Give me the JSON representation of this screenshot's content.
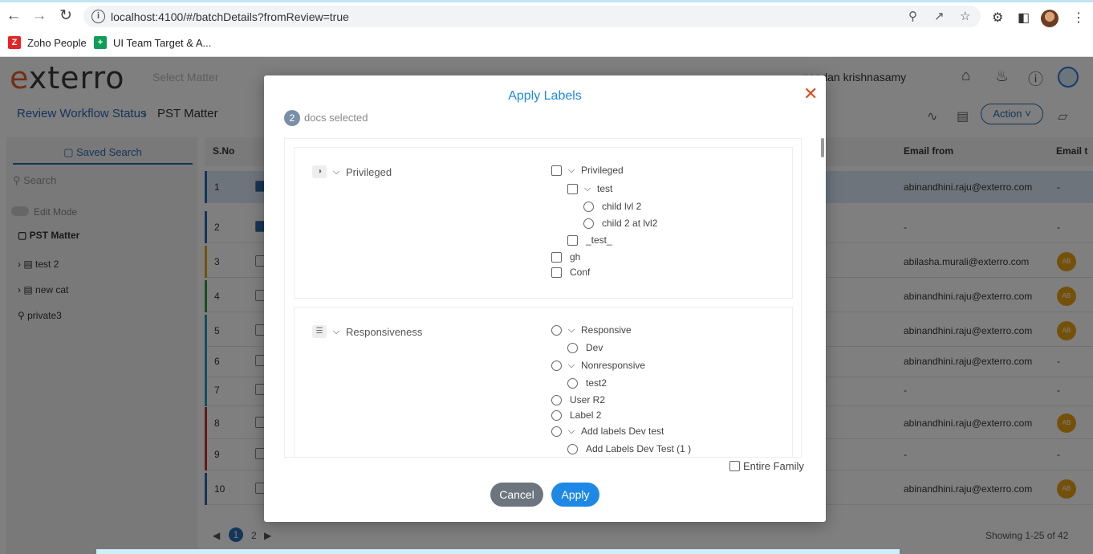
{
  "browser": {
    "url": "localhost:4100/#/batchDetails?fromReview=true",
    "bookmarks": [
      {
        "label": "Zoho People",
        "logo": "Z",
        "color": "#e42527"
      },
      {
        "label": "UI Team Target & A...",
        "logo": "+",
        "color": "#0f9d58"
      }
    ]
  },
  "app": {
    "brand": "exterro",
    "select_matter_placeholder": "Select Matter",
    "user_name": "nandan krishnasamy",
    "breadcrumb": [
      "Review Workflow Status",
      "PST Matter"
    ],
    "action_label": "Action"
  },
  "sidebar": {
    "tab_label": "Saved Search",
    "search_placeholder": "Search",
    "edit_mode_label": "Edit Mode",
    "root_label": "PST Matter",
    "items": [
      "test 2",
      "new cat",
      "private3"
    ]
  },
  "grid": {
    "columns": {
      "sno": "S.No",
      "email_from": "Email from",
      "email_to": "Email t"
    },
    "rows": [
      {
        "num": "1",
        "email": "abinandhini.raju@exterro.com",
        "right": "-"
      },
      {
        "num": "2",
        "email": "-",
        "right": "-"
      },
      {
        "num": "3",
        "email": "abilasha.murali@exterro.com",
        "right": "AB"
      },
      {
        "num": "4",
        "email": "abinandhini.raju@exterro.com",
        "right": "AB"
      },
      {
        "num": "5",
        "email": "abinandhini.raju@exterro.com",
        "right": "AB"
      },
      {
        "num": "6",
        "email": "abinandhini.raju@exterro.com",
        "right": "-"
      },
      {
        "num": "7",
        "email": "-",
        "right": "-"
      },
      {
        "num": "8",
        "email": "abinandhini.raju@exterro.com",
        "right": "AB"
      },
      {
        "num": "9",
        "email": "-",
        "right": "-"
      },
      {
        "num": "10",
        "email": "abinandhini.raju@exterro.com",
        "right": "AB"
      }
    ],
    "pages": [
      "1",
      "2"
    ],
    "showing": "Showing 1-25 of 42"
  },
  "modal": {
    "title": "Apply Labels",
    "docs_count": "2",
    "docs_label": "docs selected",
    "privileged": {
      "category": "Privileged",
      "options": {
        "privileged": "Privileged",
        "test": "test",
        "child_lvl_2": "child lvl 2",
        "child_2_at_lvl2": "child 2 at lvl2",
        "test_underscore": "_test_",
        "gh": "gh",
        "conf": "Conf"
      }
    },
    "responsiveness": {
      "category": "Responsiveness",
      "options": {
        "responsive": "Responsive",
        "dev": "Dev",
        "nonresponsive": "Nonresponsive",
        "test2": "test2",
        "user_r2": "User R2",
        "label_2": "Label 2",
        "add_labels_dev_test": "Add labels Dev test",
        "add_labels_dev_test_1": "Add Labels Dev Test (1 )"
      }
    },
    "entire_family_label": "Entire Family",
    "cancel_label": "Cancel",
    "apply_label": "Apply"
  },
  "colors": {
    "accent": "#1e88e5",
    "close": "#e04b1a",
    "cancel_bg": "#6c757d",
    "avatar": "#e8a317"
  }
}
